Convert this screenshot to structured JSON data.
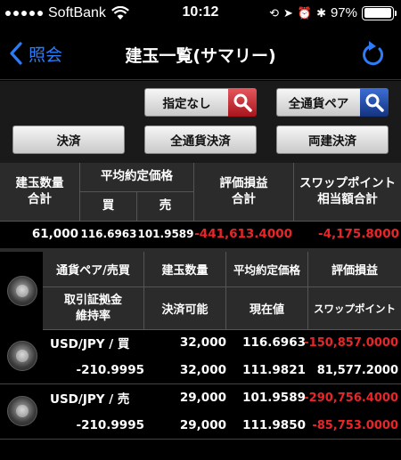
{
  "status_bar": {
    "carrier": "SoftBank",
    "time": "10:12",
    "battery": "97%",
    "battery_level": 0.97
  },
  "nav": {
    "back_label": "照会",
    "title": "建玉一覧(サマリー)"
  },
  "filters": {
    "specified_label": "指定なし",
    "pair_label": "全通貨ペア"
  },
  "actions": {
    "settle_label": "決済",
    "all_pair_settle_label": "全通貨決済",
    "both_settle_label": "両建決済"
  },
  "summary": {
    "headers": {
      "position_qty": "建玉数量\n合計",
      "avg_price": "平均約定価格",
      "buy": "買",
      "sell": "売",
      "pl": "評価損益\n合計",
      "swap": "スワップポイント\n相当額合計"
    },
    "values": {
      "position_qty": "61,000",
      "avg_buy": "116.6963",
      "avg_sell": "101.9589",
      "pl": "-441,613.4000",
      "swap": "-4,175.8000"
    }
  },
  "list_headers": {
    "pair_side": "通貨ペア/売買",
    "position_qty": "建玉数量",
    "avg_price": "平均約定価格",
    "pl": "評価損益",
    "margin_ratio": "取引証拠金\n維持率",
    "closable": "決済可能",
    "current": "現在値",
    "swap": "スワップポイント"
  },
  "positions": [
    {
      "pair_side": "USD/JPY / 買",
      "qty": "32,000",
      "avg_price": "116.6963",
      "pl": "-150,857.0000",
      "margin_ratio": "-210.9995",
      "closable": "32,000",
      "current": "111.9821",
      "swap": "81,577.2000"
    },
    {
      "pair_side": "USD/JPY / 売",
      "qty": "29,000",
      "avg_price": "101.9589",
      "pl": "-290,756.4000",
      "margin_ratio": "-210.9995",
      "closable": "29,000",
      "current": "111.9850",
      "swap": "-85,753.0000"
    }
  ],
  "colors": {
    "accent": "#2d7cf6",
    "negative": "#e8262a"
  }
}
